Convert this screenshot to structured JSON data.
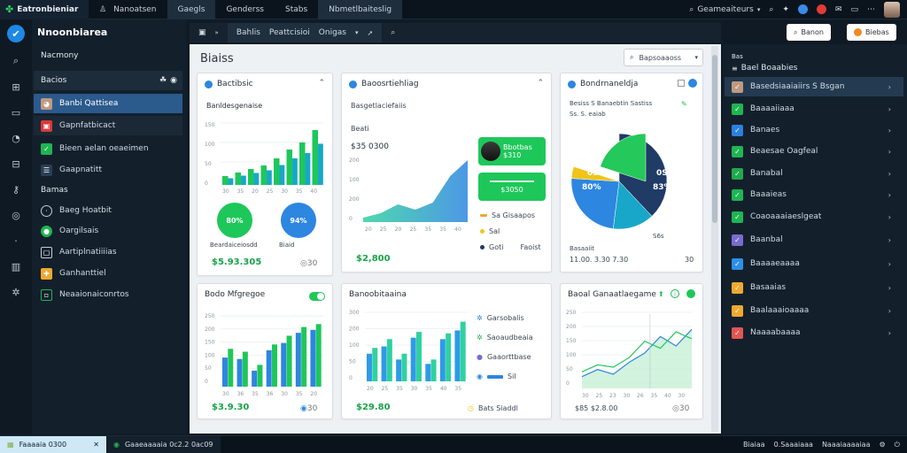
{
  "topbar": {
    "brand": "Eatronbieniar",
    "tabs": [
      "Nanoatsen",
      "Gaegls",
      "Genderss",
      "Stabs",
      "Nbmetlbaiteslig"
    ],
    "search_label": "Geameaiteurs"
  },
  "sidebar": {
    "title": "Nnoonbiarea",
    "subtitle": "Nacmony",
    "group_label": "Bacios",
    "items": [
      "Banbi Qattisea",
      "Gapnfatbicact",
      "Bieen aelan oeaeimen",
      "Gaapnatitt"
    ],
    "section": "Bamas",
    "section_items": [
      "Baeg Hoatbit",
      "Oargilsais",
      "Aartiplnatiiiias",
      "Ganhanttiel",
      "Neaaionaiconrtos"
    ]
  },
  "toolbar": {
    "items": [
      "Bahlis",
      "Peattcisioi",
      "Onigas"
    ]
  },
  "main": {
    "title": "Biaiss",
    "filter_label": "Bapsoaaoss"
  },
  "cards": {
    "c1": {
      "title": "Bactibsic",
      "subtitle": "Banldesgenaise",
      "ring1": "80%",
      "ring2": "94%",
      "caption1": "Beardaiceiosdd",
      "caption2": "Biaid",
      "value": "$5.93.305",
      "xticks": [
        "30",
        "35",
        "20",
        "25",
        "30",
        "35",
        "40"
      ],
      "yticks": [
        "150",
        "100",
        "50",
        "0"
      ],
      "bars": [
        10,
        14,
        18,
        22,
        30,
        40,
        48,
        62
      ]
    },
    "c2": {
      "title": "Baoosrtiehliag",
      "subtitle": "Basgetlaciefaiis",
      "label": "Beati",
      "amount": "$35 0300",
      "pill1_line1": "Bbotbas",
      "pill1_line2": "$310",
      "pill2": "$3050",
      "legend": [
        "Sa Gisaapos",
        "Sal",
        "Goti",
        "Faoist"
      ],
      "value": "$2,800",
      "yticks": [
        "200",
        "100",
        "200",
        "0"
      ],
      "xticks": [
        "20",
        "25",
        "20",
        "25",
        "35",
        "35",
        "40"
      ],
      "series": [
        5,
        10,
        20,
        14,
        22,
        52,
        70
      ]
    },
    "c3": {
      "title": "Bondrnaneldja",
      "subtitle": "Besiss S  Banaebtin Sastiss",
      "subtitle2": "Ss. S. eaiab",
      "left_label": "0S",
      "left_pct": "80%",
      "right_label": "0S",
      "right_pct": "83%",
      "below_label": "S6s",
      "footer_label": "Basaaiit",
      "footer_value": "11.00. 3.30 7.30",
      "footer_right": "30",
      "slices": [
        {
          "label": "navy",
          "value": 38,
          "color": "#1f3b66"
        },
        {
          "label": "teal",
          "value": 14,
          "color": "#18a7c9"
        },
        {
          "label": "blue",
          "value": 24,
          "color": "#2d86e0"
        },
        {
          "label": "yellow",
          "value": 4,
          "color": "#f0c419"
        },
        {
          "label": "green",
          "value": 20,
          "color": "#25c85a"
        }
      ]
    },
    "c4": {
      "title": "Bodo Mfgregoe",
      "value": "$3.9.30",
      "yticks": [
        "250",
        "200",
        "150",
        "100",
        "50",
        "0"
      ],
      "xticks": [
        "30",
        "36",
        "35",
        "36",
        "30",
        "35",
        "20"
      ],
      "bars": [
        [
          40,
          52
        ],
        [
          38,
          48
        ],
        [
          22,
          30
        ],
        [
          50,
          58
        ],
        [
          60,
          70
        ],
        [
          74,
          82
        ],
        [
          78,
          86
        ]
      ]
    },
    "c5": {
      "title": "Banoobitaaina",
      "legend": [
        "Garsobalis",
        "Saoaudbeaia",
        "Gaaorttbase",
        "Sil"
      ],
      "value": "$29.80",
      "footer": "Bats Siaddl",
      "yticks": [
        "300",
        "200",
        "100",
        "50",
        "0"
      ],
      "xticks": [
        "20",
        "25",
        "35",
        "30",
        "35",
        "40",
        "35"
      ],
      "bars": [
        [
          38,
          46
        ],
        [
          48,
          58
        ],
        [
          30,
          38
        ],
        [
          60,
          68
        ],
        [
          24,
          30
        ],
        [
          58,
          66
        ],
        [
          70,
          82
        ]
      ]
    },
    "c6": {
      "title": "Baoal Ganaatlaegame",
      "value": "$85 $2.8.00",
      "yticks": [
        "250",
        "200",
        "150",
        "100",
        "50",
        "0"
      ],
      "xticks": [
        "30",
        "25",
        "23",
        "30",
        "26",
        "35",
        "40",
        "30"
      ],
      "series_a": [
        10,
        16,
        12,
        22,
        30,
        44,
        36,
        50
      ],
      "series_b": [
        14,
        20,
        18,
        26,
        40,
        34,
        48,
        42
      ]
    }
  },
  "rightpanel": {
    "btn1": "Banon",
    "btn2": "Biebas",
    "heading_small": "Bas",
    "heading": "Bael Boaabies",
    "items": [
      {
        "label": "Basedsiaaiaiirs S Bsgan",
        "icon_color": "#c09a80"
      },
      {
        "label": "Baaaaiiaaa",
        "icon_color": "#1fb552"
      },
      {
        "label": "Banaes",
        "icon_color": "#2d7fe0"
      },
      {
        "label": "Beaesae Oagfeal",
        "icon_color": "#1fb552"
      },
      {
        "label": "Banabal",
        "icon_color": "#23a84d"
      },
      {
        "label": "Baaaieas",
        "icon_color": "#1fb552"
      },
      {
        "label": "Coaoaaaiaeslgeat",
        "icon_color": "#1fb552"
      },
      {
        "label": "Baanbal",
        "icon_color": "#7a6bd0"
      },
      {
        "label": "Baaaaeaaaa",
        "icon_color": "#2d8fe6"
      },
      {
        "label": "Basaaias",
        "icon_color": "#f0a830"
      },
      {
        "label": "Baalaaaioaaaa",
        "icon_color": "#f0a830"
      },
      {
        "label": "Naaaabaaaa",
        "icon_color": "#e25555"
      }
    ]
  },
  "statusbar": {
    "left": "Faaaaia 0300",
    "mid": "Gaaeaaaaia 0c2.2 0ac09",
    "right1": "Biaiaa",
    "right2": "0.Saaaiaaa",
    "right3": "Naaaiaaaaiaa"
  },
  "colors": {
    "accent_green": "#1ec75a",
    "accent_blue": "#2d86e0",
    "sidebar_active": "#2b5a8c"
  }
}
